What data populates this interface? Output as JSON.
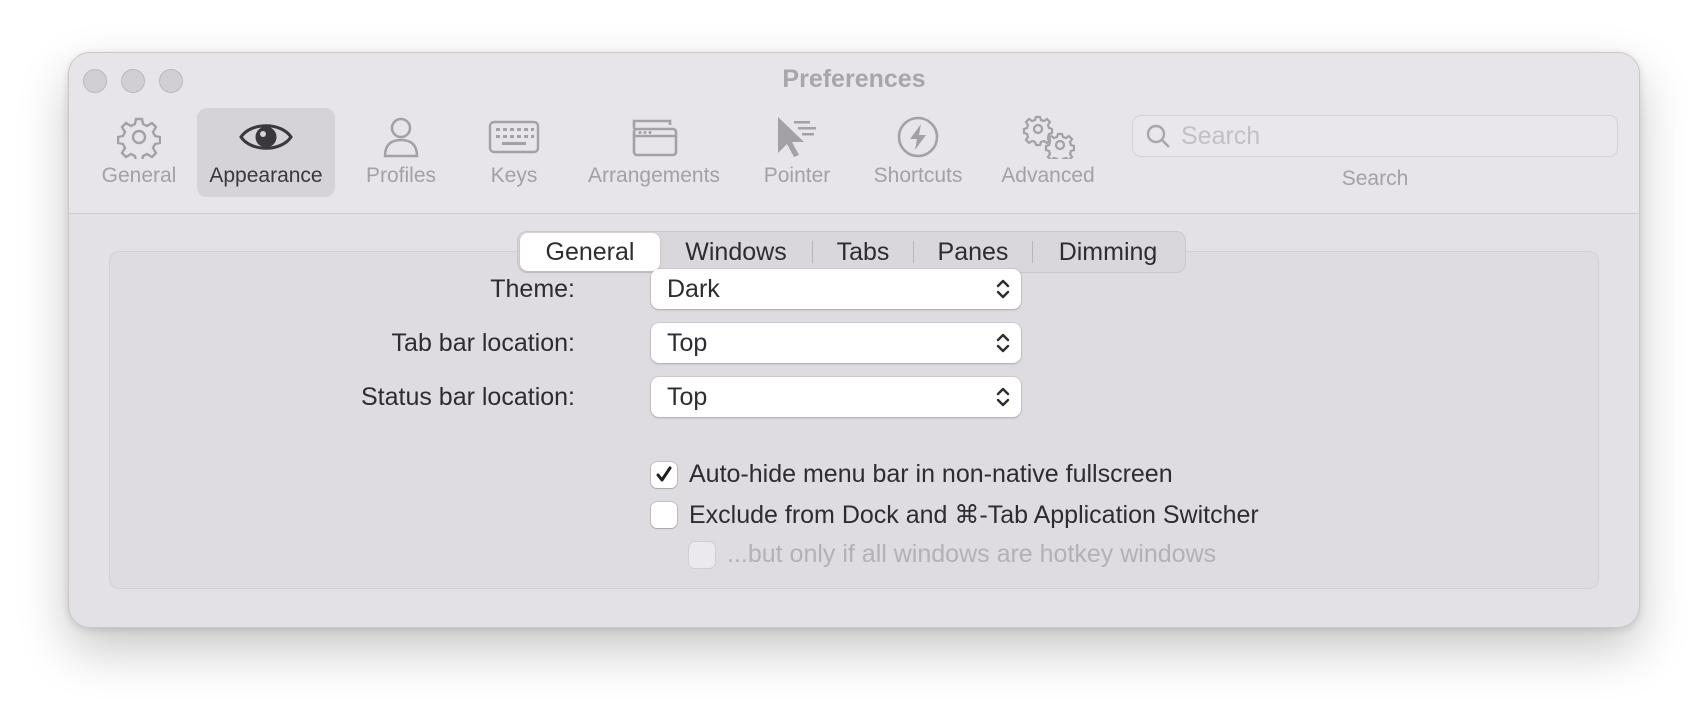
{
  "window": {
    "title": "Preferences"
  },
  "toolbar": {
    "items": [
      {
        "label": "General",
        "icon": "gear-icon"
      },
      {
        "label": "Appearance",
        "icon": "eye-icon",
        "selected": true
      },
      {
        "label": "Profiles",
        "icon": "person-icon"
      },
      {
        "label": "Keys",
        "icon": "keyboard-icon"
      },
      {
        "label": "Arrangements",
        "icon": "windows-icon"
      },
      {
        "label": "Pointer",
        "icon": "pointer-icon"
      },
      {
        "label": "Shortcuts",
        "icon": "lightning-icon"
      },
      {
        "label": "Advanced",
        "icon": "gears-icon"
      }
    ],
    "search": {
      "placeholder": "Search",
      "label": "Search"
    }
  },
  "tabs": {
    "items": [
      "General",
      "Windows",
      "Tabs",
      "Panes",
      "Dimming"
    ],
    "selected": "General"
  },
  "settings": {
    "theme": {
      "label": "Theme:",
      "value": "Dark"
    },
    "tab_bar": {
      "label": "Tab bar location:",
      "value": "Top"
    },
    "status_bar": {
      "label": "Status bar location:",
      "value": "Top"
    },
    "checkboxes": [
      {
        "label": "Auto-hide menu bar in non-native fullscreen",
        "checked": true,
        "enabled": true
      },
      {
        "label": "Exclude from Dock and ⌘-Tab Application Switcher",
        "checked": false,
        "enabled": true
      },
      {
        "label": "...but only if all windows are hotkey windows",
        "checked": false,
        "enabled": false
      }
    ]
  },
  "colors": {
    "window_bg": "#e3e0e6",
    "selected_toolbar_bg": "#d5d2d8",
    "text_primary": "#2e2c30",
    "text_disabled": "#b3b0b6"
  }
}
